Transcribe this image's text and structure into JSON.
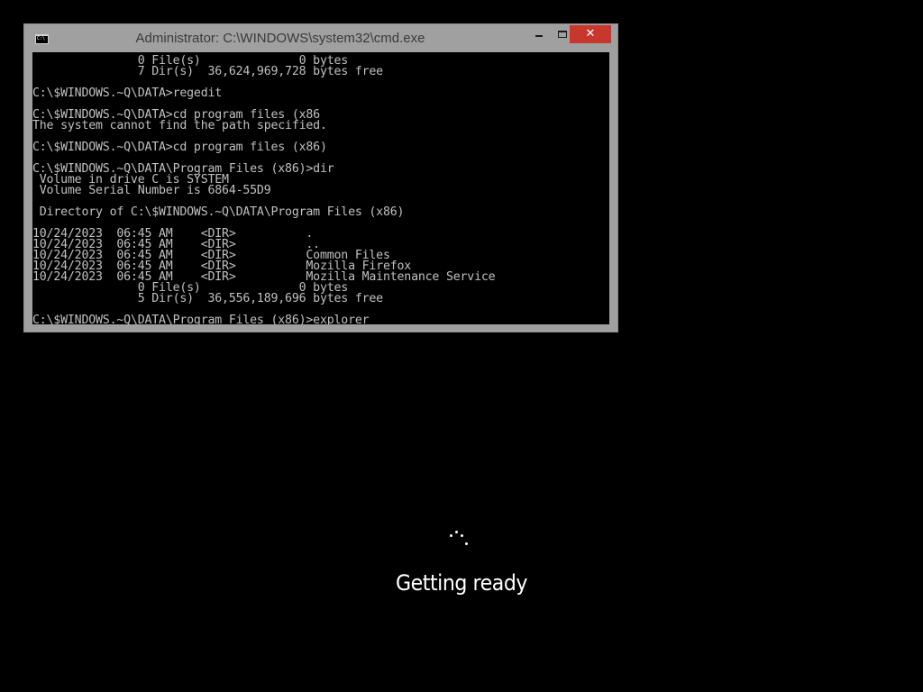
{
  "window": {
    "title": "Administrator: C:\\WINDOWS\\system32\\cmd.exe",
    "icon": "cmd-icon",
    "icon_text": "C:\\",
    "close_glyph": "✕",
    "titlebar_color": "#a0a0a0",
    "close_color": "#c7372e"
  },
  "console": {
    "background": "#000000",
    "foreground": "#c0c0c0",
    "lines": [
      "               0 File(s)              0 bytes",
      "               7 Dir(s)  36,624,969,728 bytes free",
      "",
      "C:\\$WINDOWS.~Q\\DATA>regedit",
      "",
      "C:\\$WINDOWS.~Q\\DATA>cd program files (x86",
      "The system cannot find the path specified.",
      "",
      "C:\\$WINDOWS.~Q\\DATA>cd program files (x86)",
      "",
      "C:\\$WINDOWS.~Q\\DATA\\Program Files (x86)>dir",
      " Volume in drive C is SYSTEM",
      " Volume Serial Number is 6864-55D9",
      "",
      " Directory of C:\\$WINDOWS.~Q\\DATA\\Program Files (x86)",
      "",
      "10/24/2023  06:45 AM    <DIR>          .",
      "10/24/2023  06:45 AM    <DIR>          ..",
      "10/24/2023  06:45 AM    <DIR>          Common Files",
      "10/24/2023  06:45 AM    <DIR>          Mozilla Firefox",
      "10/24/2023  06:45 AM    <DIR>          Mozilla Maintenance Service",
      "               0 File(s)              0 bytes",
      "               5 Dir(s)  36,556,189,696 bytes free",
      "",
      "C:\\$WINDOWS.~Q\\DATA\\Program Files (x86)>explorer"
    ]
  },
  "setup": {
    "status": "Getting ready",
    "spinner_icon": "loading-spinner-icon"
  }
}
